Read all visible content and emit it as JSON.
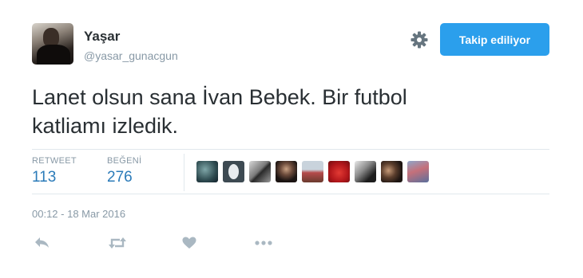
{
  "user": {
    "display_name": "Yaşar",
    "handle": "@yasar_gunacgun"
  },
  "follow_button": {
    "label": "Takip ediliyor"
  },
  "tweet": {
    "text_line1": "Lanet olsun sana İvan Bebek. Bir futbol",
    "text_line2": "katliamı izledik.",
    "timestamp": "00:12 - 18 Mar 2016"
  },
  "stats": {
    "retweet_label": "RETWEET",
    "retweet_count": "113",
    "like_label": "BEĞENİ",
    "like_count": "276"
  },
  "likers_count_shown": 9,
  "icons": {
    "settings": "gear-icon",
    "reply": "reply-icon",
    "retweet": "retweet-icon",
    "like": "heart-icon",
    "more": "more-dots-icon"
  },
  "colors": {
    "accent": "#2b9fec",
    "link": "#2b7bb9",
    "muted": "#8899a6",
    "text": "#292f33",
    "action_icon": "#aab8c2"
  }
}
